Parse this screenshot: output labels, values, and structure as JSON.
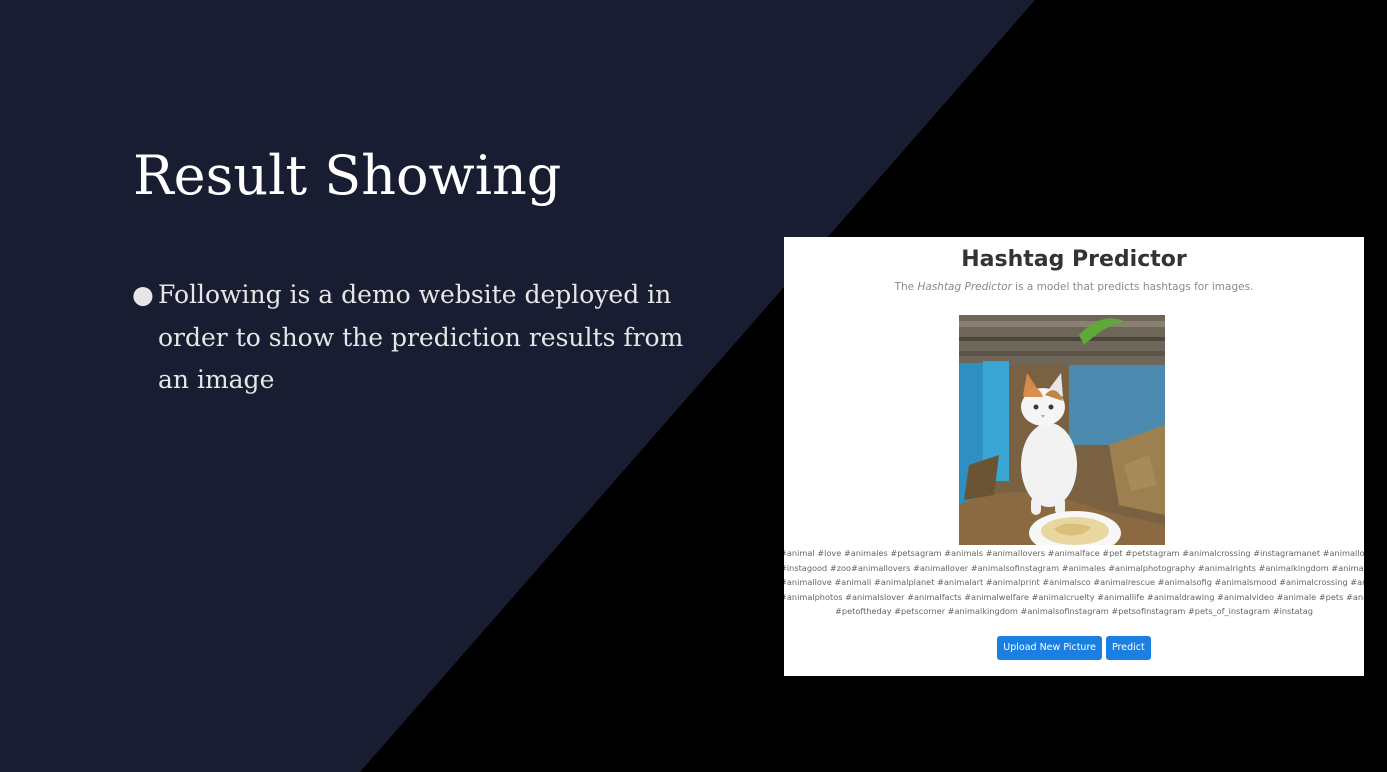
{
  "slide": {
    "title": "Result Showing",
    "bullet_marker": "●",
    "bullets": [
      "Following is a demo website deployed in order to show the prediction results from an image"
    ],
    "colors": {
      "panel": "#181d32",
      "background": "#000000",
      "text": "#ffffff"
    }
  },
  "demo_site": {
    "title": "Hashtag Predictor",
    "subtitle_prefix": "The ",
    "subtitle_em": "Hashtag Predictor",
    "subtitle_suffix": " is a model that predicts hashtags for images.",
    "image_alt": "photo of a white and orange kitten sitting among leaves next to a food bowl",
    "hashtag_lines": [
      "#animal #love #animales #petsagram #animals #animallovers #animalface #pet #petstagram #animalcrossing #instagramanet #animallover #cute",
      "#instagood #zoo#animallovers #animallover #animalsofinstagram #animales #animalphotography #animalrights #animalkingdom #animaladdicts",
      "#animallove #animali #animalplanet #animalart #animalprint #animalsco #animalrescue #animalsofig #animalsmood #animalcrossing #animalliberation",
      "#animalphotos #animalslover #animalfacts #animalwelfare #animalcruelty #animallife #animaldrawing #animalvideo #animale #pets #animalprint #nature",
      "#petoftheday #petscorner #animalkingdom #animalsofinstagram #petsofinstagram #pets_of_instagram #instatag"
    ],
    "buttons": {
      "upload_label": "Upload New Picture",
      "predict_label": "Predict"
    },
    "colors": {
      "button": "#1a7fe0",
      "title": "#333333"
    }
  }
}
